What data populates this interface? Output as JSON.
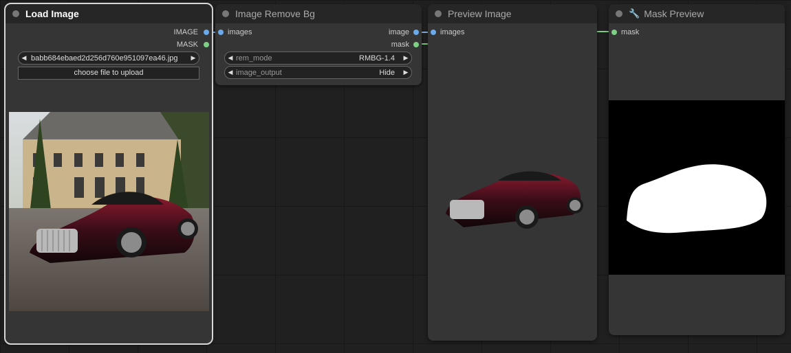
{
  "nodes": {
    "load_image": {
      "title": "Load Image",
      "outputs": [
        "IMAGE",
        "MASK"
      ],
      "image_widget": "babb684ebaed2d256d760e951097ea46.jpg",
      "upload_label": "choose file to upload"
    },
    "remove_bg": {
      "title": "Image Remove Bg",
      "input": "images",
      "outputs": [
        "image",
        "mask"
      ],
      "widgets": [
        {
          "label": "rem_mode",
          "value": "RMBG-1.4"
        },
        {
          "label": "image_output",
          "value": "Hide"
        }
      ]
    },
    "preview_image": {
      "title": "Preview Image",
      "input": "images"
    },
    "mask_preview": {
      "title": "Mask Preview",
      "input": "mask"
    }
  },
  "colors": {
    "canvas": "#202020",
    "node_body": "#353535",
    "node_header": "#262626",
    "image_slot": "#6aa9ea",
    "mask_slot": "#7ecf86"
  },
  "icons": [
    "wrench-icon",
    "left-arrow-icon",
    "right-arrow-icon"
  ]
}
